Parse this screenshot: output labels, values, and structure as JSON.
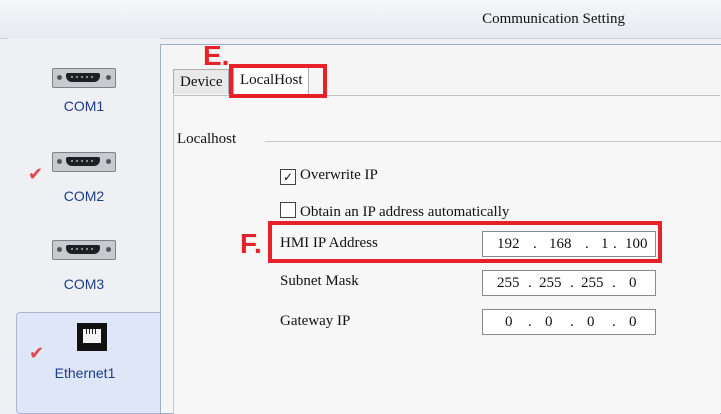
{
  "window": {
    "title": "Communication Setting"
  },
  "sidebar": {
    "items": [
      {
        "label": "COM1",
        "icon": "serial-port-icon",
        "checked": false,
        "selected": false
      },
      {
        "label": "COM2",
        "icon": "serial-port-icon",
        "checked": true,
        "selected": false
      },
      {
        "label": "COM3",
        "icon": "serial-port-icon",
        "checked": false,
        "selected": false
      },
      {
        "label": "Ethernet1",
        "icon": "ethernet-port-icon",
        "checked": true,
        "selected": true
      }
    ],
    "check_glyph": "✔"
  },
  "tabs": [
    {
      "label": "Device",
      "active": false
    },
    {
      "label": "LocalHost",
      "active": true
    }
  ],
  "localhost": {
    "group_title": "Localhost",
    "overwrite_ip": {
      "label": "Overwrite IP",
      "checked": true,
      "glyph": "✓"
    },
    "auto_ip": {
      "label": "Obtain an IP address automatically",
      "checked": false
    },
    "hmi_ip": {
      "label": "HMI IP Address",
      "octets": [
        "192",
        "168",
        "1",
        "100"
      ]
    },
    "subnet": {
      "label": "Subnet Mask",
      "octets": [
        "255",
        "255",
        "255",
        "0"
      ]
    },
    "gateway": {
      "label": "Gateway IP",
      "octets": [
        "0",
        "0",
        "0",
        "0"
      ]
    },
    "dot": "."
  },
  "annotations": {
    "e": {
      "letter": "E.",
      "color": "#e6212a"
    },
    "f": {
      "letter": "F.",
      "color": "#e6212a"
    }
  },
  "colors": {
    "accent": "#e6212a",
    "sidebar_selected": "#dfe6f7",
    "port_label": "#1b3d8a"
  }
}
